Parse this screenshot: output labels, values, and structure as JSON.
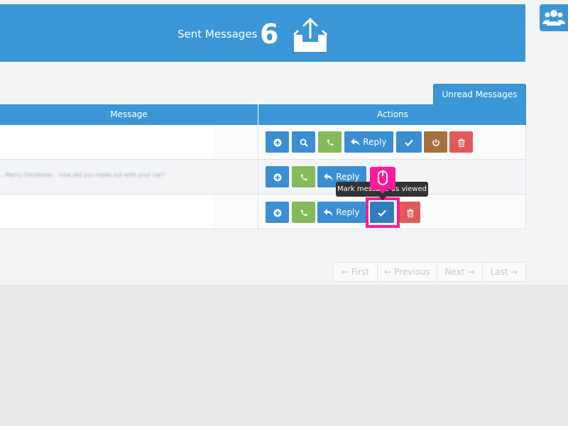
{
  "header": {
    "title": "Sent Messages",
    "count": "6",
    "icon": "outbox-upload-icon"
  },
  "side_button": {
    "icon": "users-icon"
  },
  "tabs": {
    "unread": "Unread Messages"
  },
  "table": {
    "columns": [
      "Message",
      "Actions"
    ],
    "rows": [
      {
        "message": "",
        "actions": [
          "add",
          "search",
          "call",
          "reply",
          "mark-viewed",
          "power",
          "delete"
        ]
      },
      {
        "message": "...Merry Christmas... how did you make out with your car?",
        "actions": [
          "add",
          "call",
          "reply"
        ]
      },
      {
        "message": "",
        "actions": [
          "add",
          "call",
          "reply",
          "mark-viewed",
          "delete"
        ]
      }
    ]
  },
  "labels": {
    "reply": "Reply"
  },
  "tooltip": {
    "text": "Mark message as viewed"
  },
  "pagination": {
    "first": "← First",
    "previous": "← Previous",
    "next": "Next →",
    "last": "Last →"
  },
  "colors": {
    "primary": "#3a96d6",
    "success": "#84bb5a",
    "warning": "#a6703c",
    "danger": "#e05a5a",
    "highlight": "#ff1a9b"
  }
}
